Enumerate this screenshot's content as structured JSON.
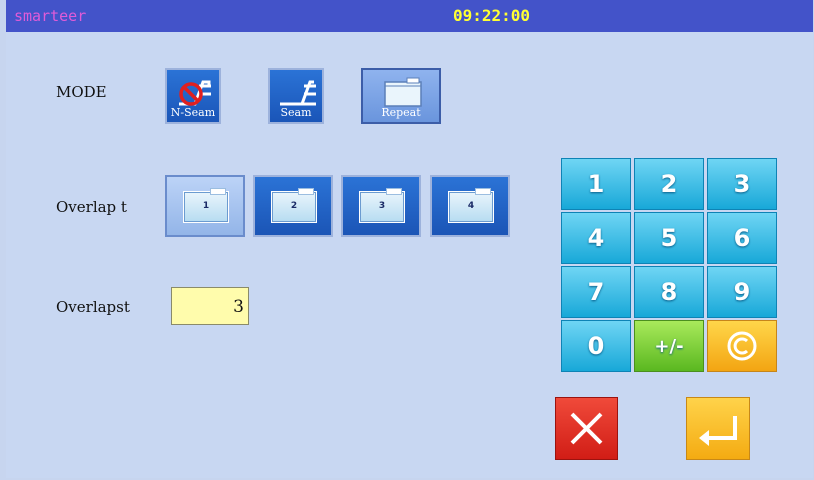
{
  "app": {
    "brand": "smarteer",
    "clock": "09:22:00"
  },
  "mode": {
    "label": "MODE",
    "buttons": [
      {
        "label": "N-Seam",
        "icon": "no-seam-icon",
        "selected": false
      },
      {
        "label": "Seam",
        "icon": "seam-icon",
        "selected": false
      },
      {
        "label": "Repeat",
        "icon": "repeat-icon",
        "selected": true
      }
    ]
  },
  "overlap": {
    "label": "Overlap t",
    "options": [
      {
        "label": "1",
        "selected": true
      },
      {
        "label": "2",
        "selected": false
      },
      {
        "label": "3",
        "selected": false
      },
      {
        "label": "4",
        "selected": false
      }
    ]
  },
  "overlaps": {
    "label": "Overlapst",
    "value": "3"
  },
  "keypad": {
    "keys": [
      "1",
      "2",
      "3",
      "4",
      "5",
      "6",
      "7",
      "8",
      "9",
      "0",
      "+/-",
      "C"
    ]
  },
  "actions": {
    "cancel_icon": "close-icon",
    "enter_icon": "enter-icon"
  },
  "colors": {
    "background": "#c8d7f2",
    "topbar": "#4353c9",
    "brand": "#e05bd8",
    "clock": "#ffff33",
    "key": "#18a8d8",
    "sign_key": "#5ab820",
    "clear_key": "#f3a512",
    "cancel": "#d11d16",
    "enter": "#f4ab12",
    "value_box": "#fffcac"
  }
}
